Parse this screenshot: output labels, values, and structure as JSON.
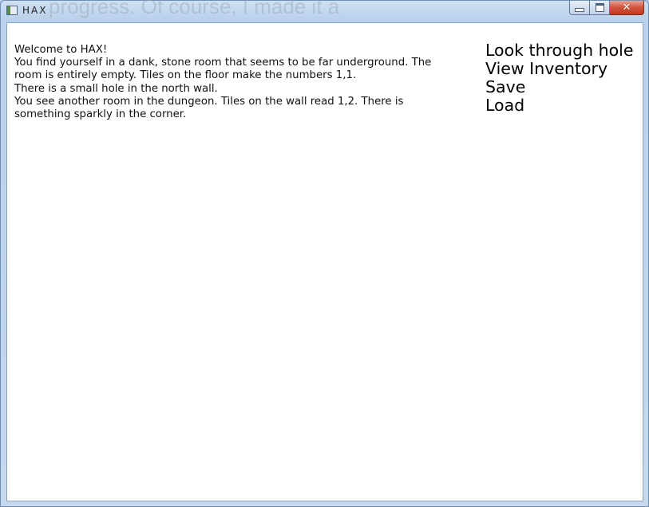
{
  "window": {
    "title": "HAX",
    "background_ghost_text": "progress. Of course, I made it a",
    "caption_buttons": {
      "minimize_icon": "minimize-icon",
      "maximize_icon": "maximize-icon",
      "close_icon": "close-icon",
      "close_glyph": "✕"
    }
  },
  "story": {
    "lines": [
      "Welcome to HAX!",
      "You find yourself in a dank, stone room that seems to be far underground. The room is entirely empty. Tiles on the floor make the numbers 1,1.",
      "There is a small hole in the north wall.",
      "You see another room in the dungeon. Tiles on the wall read 1,2. There is something sparkly in the corner."
    ]
  },
  "menu": {
    "items": [
      "Look through hole",
      "View Inventory",
      "Save",
      "Load"
    ]
  },
  "colors": {
    "frame": "#b9d1ea",
    "close_button": "#c0391f",
    "client_background": "#ffffff"
  }
}
